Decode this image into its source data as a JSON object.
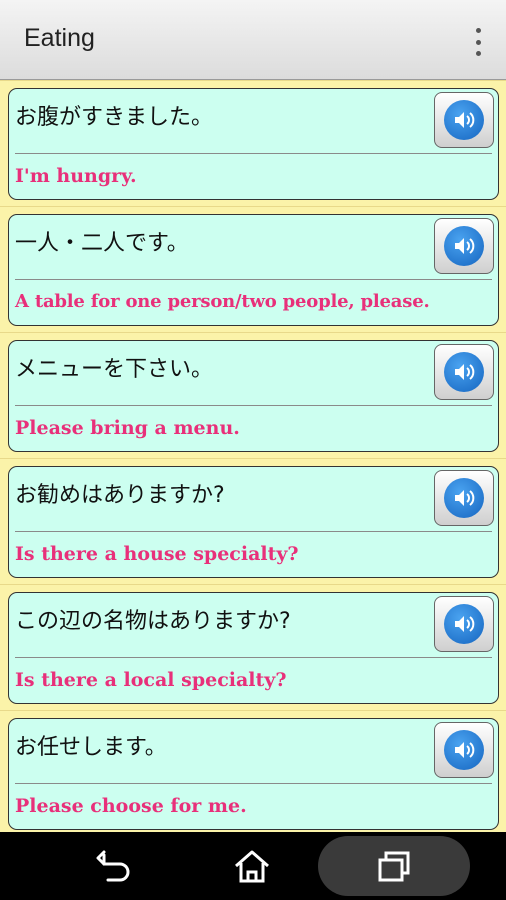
{
  "appbar": {
    "title": "Eating",
    "menu_icon": "overflow-menu-icon"
  },
  "phrases": [
    {
      "jp": "お腹がすきました。",
      "en": "I'm hungry."
    },
    {
      "jp": "一人・二人です。",
      "en": "A table for one person/two people, please."
    },
    {
      "jp": "メニューを下さい。",
      "en": "Please bring a menu."
    },
    {
      "jp": "お勧めはありますか?",
      "en": "Is there a house specialty?"
    },
    {
      "jp": "この辺の名物はありますか?",
      "en": "Is there a local specialty?"
    },
    {
      "jp": "お任せします。",
      "en": "Please choose for me."
    }
  ],
  "play_icon": "speaker-icon",
  "colors": {
    "accent_text": "#e8307a",
    "card_bg": "#ccfff0",
    "page_bg": "#fbf3a9",
    "play_blue": "#1565c0"
  },
  "navbar": {
    "back_icon": "back-icon",
    "home_icon": "home-icon",
    "recent_icon": "recent-apps-icon"
  }
}
